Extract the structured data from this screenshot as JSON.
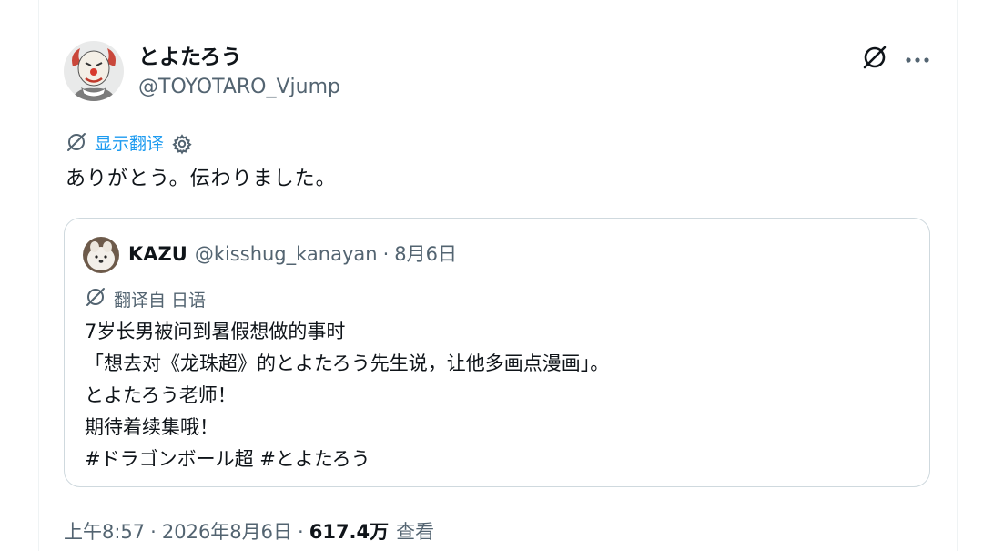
{
  "tweet": {
    "author_name": "とよたろう",
    "author_handle": "@TOYOTARO_Vjump",
    "translate_link": "显示翻译",
    "text": "ありがとう。伝わりました。",
    "time": "上午8:57",
    "date": "2026年8月6日",
    "views_count": "617.4万",
    "views_label": "查看",
    "meta_separator": "·"
  },
  "quoted": {
    "name": "KAZU",
    "handle": "@kisshug_kanayan",
    "separator": "·",
    "date": "8月6日",
    "translated_from": "翻译自 日语",
    "lines": [
      "7岁长男被问到暑假想做的事时",
      "「想去对《龙珠超》的とよたろう先生说，让他多画点漫画」。",
      "とよたろう老师！",
      "期待着续集哦！",
      "#ドラゴンボール超 #とよたろう"
    ]
  },
  "icons": {
    "grok": "grok-slash-icon",
    "more": "more-dots-icon",
    "translate": "translate-slash-icon",
    "settings": "gear-icon"
  },
  "colors": {
    "link": "#1d9bf0",
    "secondary_text": "#536471",
    "border": "#cfd9de"
  }
}
